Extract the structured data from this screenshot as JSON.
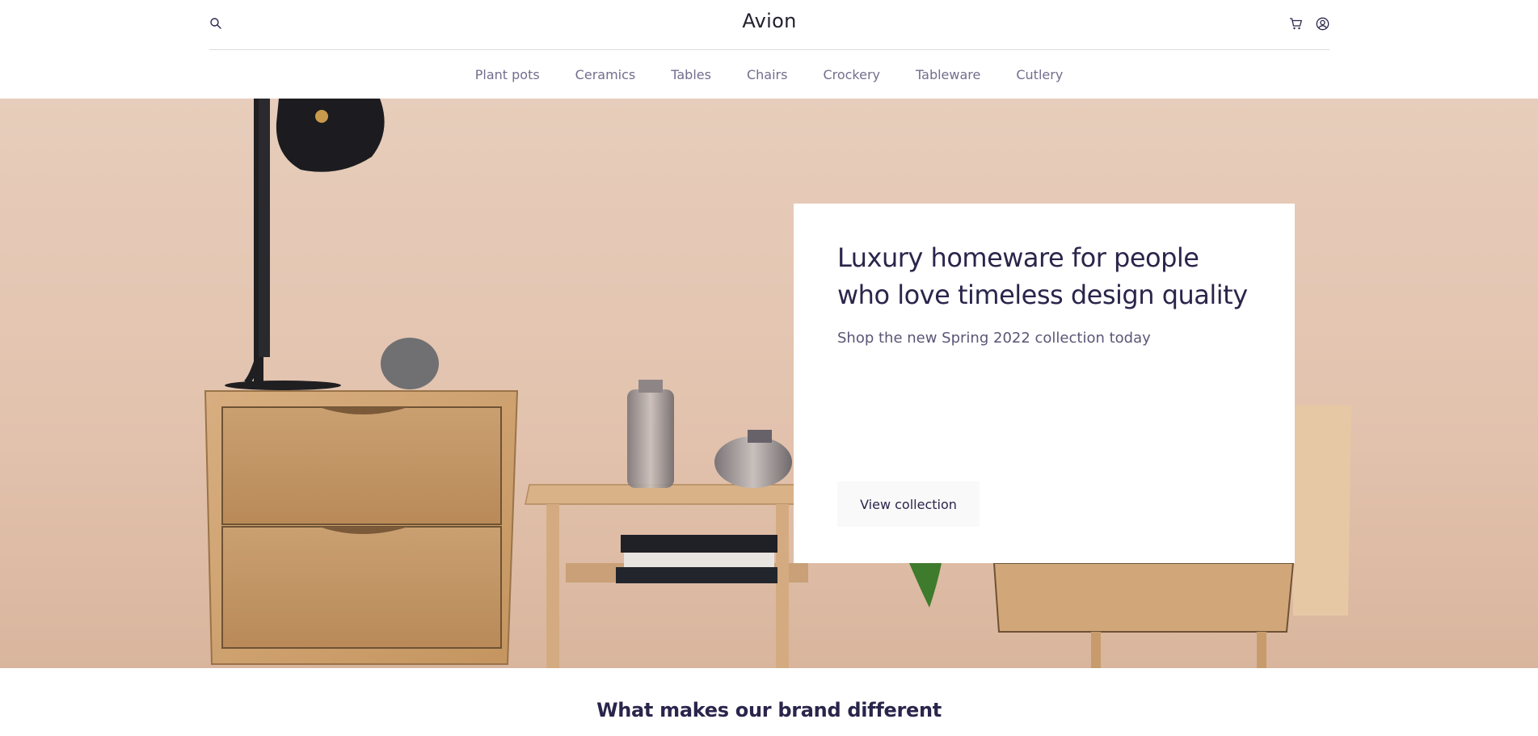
{
  "header": {
    "brand": "Avion",
    "icons": [
      "search-icon",
      "cart-icon",
      "user-icon"
    ]
  },
  "nav": {
    "items": [
      "Plant pots",
      "Ceramics",
      "Tables",
      "Chairs",
      "Crockery",
      "Tableware",
      "Cutlery"
    ]
  },
  "hero": {
    "title": "Luxury homeware for people who love timeless design quality",
    "subtitle": "Shop the new Spring 2022 collection today",
    "cta": "View collection",
    "background": "#e3c6b2",
    "image_subject": "wooden bedside drawers with black lamp, vases and books against peach wall"
  },
  "features": {
    "title": "What makes our brand different"
  },
  "colors": {
    "primary": "#2a254b",
    "muted": "#726e8d",
    "button_bg": "#f9f9f9"
  }
}
